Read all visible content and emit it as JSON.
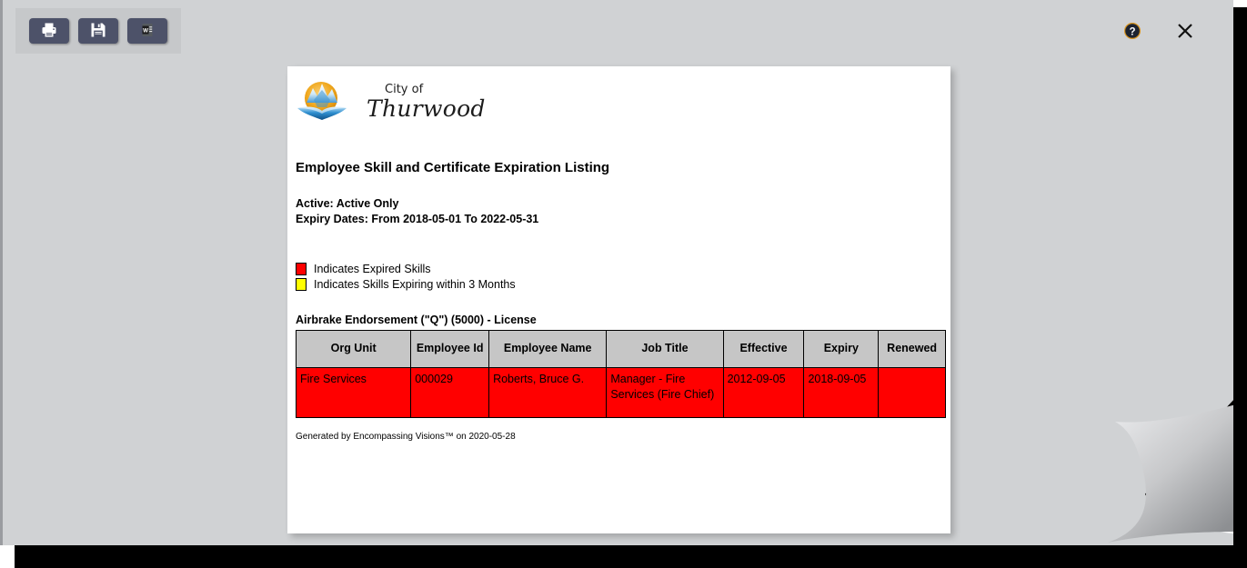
{
  "window": {
    "toolbar": {
      "print_label": "Print",
      "save_label": "Save",
      "word_label": "Export to Word"
    },
    "help_label": "Help",
    "close_label": "Close"
  },
  "document": {
    "logo": {
      "line1": "City of",
      "line2": "Thurwood",
      "icon": "city-seal-icon"
    },
    "title": "Employee Skill and Certificate Expiration Listing",
    "filters": {
      "active": "Active: Active Only",
      "expiry_dates": "Expiry Dates: From 2018-05-01 To 2022-05-31"
    },
    "legend": [
      {
        "color": "#ff0000",
        "label": "Indicates Expired Skills"
      },
      {
        "color": "#ffff00",
        "label": "Indicates Skills Expiring within 3 Months"
      }
    ],
    "section_heading": "Airbrake Endorsement (\"Q\") (5000) - License",
    "table": {
      "headers": [
        "Org Unit",
        "Employee Id",
        "Employee Name",
        "Job Title",
        "Effective",
        "Expiry",
        "Renewed"
      ],
      "rows": [
        {
          "status": "expired",
          "org_unit": "Fire Services",
          "employee_id": "000029",
          "employee_name": "Roberts, Bruce G.",
          "job_title": "Manager - Fire Services (Fire Chief)",
          "effective": "2012-09-05",
          "expiry": "2018-09-05",
          "renewed": ""
        }
      ]
    },
    "footer": "Generated by Encompassing Visions™ on 2020-05-28"
  }
}
